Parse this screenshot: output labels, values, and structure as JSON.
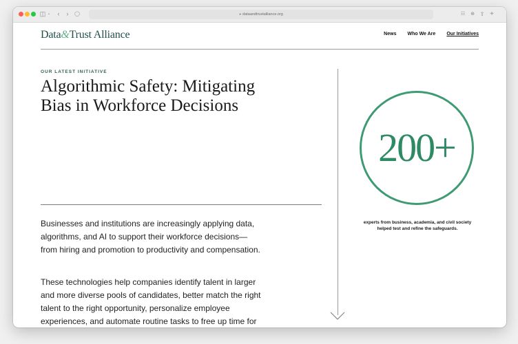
{
  "browser": {
    "url": "dataandtrustalliance.org",
    "icons": [
      "sidebar-toggle-icon",
      "chevron-down-icon",
      "back-icon",
      "forward-icon",
      "shield-icon",
      "translate-icon",
      "download-icon",
      "share-icon",
      "new-tab-icon"
    ]
  },
  "site": {
    "logo_part1": "Data",
    "logo_amp": "&",
    "logo_part2": "Trust Alliance",
    "nav": [
      "News",
      "Who We Are",
      "Our Initiatives"
    ],
    "active_nav": "Our Initiatives"
  },
  "main": {
    "eyebrow": "OUR LATEST INITIATIVE",
    "title": "Algorithmic Safety: Mitigating Bias in Workforce Decisions",
    "paragraph1": "Businesses and institutions are increasingly applying data, algorithms, and AI to support their workforce decisions—from hiring and promotion to productivity and compensation.",
    "paragraph2": "These technologies help companies identify talent in larger and more diverse pools of candidates, better match the right talent to the right opportunity, personalize employee experiences, and automate routine tasks to free up time for"
  },
  "stat": {
    "value": "200+",
    "caption": "experts from business, academia, and civil society helped test and refine the safeguards."
  },
  "colors": {
    "brand_green": "#3e9a73",
    "logo_teal": "#1f4e4b"
  }
}
